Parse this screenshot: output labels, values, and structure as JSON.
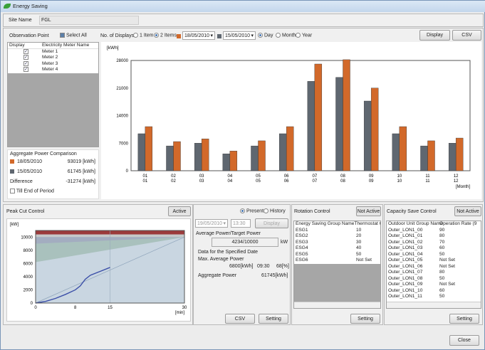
{
  "window": {
    "title": "Energy Saving"
  },
  "site": {
    "label": "Site Name",
    "value": "FGL"
  },
  "observation": {
    "label": "Observation Point",
    "select_all": "Select All",
    "columns": [
      "Display",
      "Electricity Meter Name"
    ],
    "meters": [
      {
        "name": "Meter 1",
        "checked": true
      },
      {
        "name": "Meter 2",
        "checked": true
      },
      {
        "name": "Meter 3",
        "checked": true
      },
      {
        "name": "Meter 4",
        "checked": true
      }
    ]
  },
  "displays": {
    "label": "No. of Displays",
    "opt1": "1 Item",
    "opt2": "2 Items",
    "selected": "2 Items",
    "date1": "18/05/2010",
    "date2": "15/05/2010",
    "period_day": "Day",
    "period_month": "Month",
    "period_year": "Year",
    "period_selected": "Day",
    "display_btn": "Display",
    "csv_btn": "CSV"
  },
  "aggregate": {
    "title": "Aggregate Power Comparison",
    "row1_date": "18/05/2010",
    "row1_value": "93019 [kWh]",
    "row2_date": "15/05/2010",
    "row2_value": "61745 [kWh]",
    "diff_label": "Difference",
    "diff_value": "-31274 [kWh]",
    "till_end": "Till End of Period"
  },
  "colors": {
    "series1": "#d2692a",
    "series2": "#5f6770",
    "peak_red": "#9b3b3b"
  },
  "chart_data": {
    "type": "bar",
    "ylabel": "[kWh]",
    "xlabel": "[Month]",
    "ylim": [
      0,
      28000
    ],
    "yticks": [
      "0",
      "7000",
      "14000",
      "21000",
      "28000"
    ],
    "categories": [
      "01\n01",
      "02\n02",
      "03\n03",
      "04\n04",
      "05\n05",
      "06\n06",
      "07\n07",
      "08\n08",
      "09\n09",
      "10\n10",
      "11\n11",
      "12\n12"
    ],
    "series": [
      {
        "values": [
          9400,
          6300,
          7000,
          4300,
          6300,
          9400,
          22700,
          23700,
          17700,
          9400,
          6300,
          7000
        ]
      },
      {
        "values": [
          11200,
          7400,
          8100,
          5000,
          7600,
          11200,
          27100,
          28200,
          21000,
          11200,
          7600,
          8300
        ]
      }
    ]
  },
  "peak": {
    "title": "Peak Cut Control",
    "status": "Active",
    "ylabel": "[kW]",
    "xlabel": "[min]",
    "yticks": [
      "0",
      "2000",
      "4000",
      "6000",
      "8000",
      "10000"
    ],
    "xticks": [
      "0",
      "8",
      "15",
      "30"
    ],
    "present": "Present",
    "history": "History",
    "date": "19/05/2010",
    "time": "13:30",
    "display_btn": "Display",
    "avg_label": "Average Power/Target Power",
    "avg_value": "4234/10000",
    "avg_unit": "kW",
    "specified": "Data for the Specified Date",
    "max_label": "Max. Average Power",
    "max_value": "6800[kWh]",
    "max_time": "09:30",
    "max_pct": "68[%]",
    "agg_label": "Aggregate Power",
    "agg_value": "61745[kWh]",
    "csv_btn": "CSV",
    "setting_btn": "Setting"
  },
  "rotation": {
    "title": "Rotation Control",
    "status": "Not Active",
    "columns": [
      "Energy Saving Group Name",
      "Thermostat C"
    ],
    "rows": [
      [
        "ESG1",
        "10"
      ],
      [
        "ESG2",
        "20"
      ],
      [
        "ESG3",
        "30"
      ],
      [
        "ESG4",
        "40"
      ],
      [
        "ESG5",
        "50"
      ],
      [
        "ESG6",
        "Not Set"
      ]
    ],
    "setting_btn": "Setting"
  },
  "capacity": {
    "title": "Capacity Save Control",
    "status": "Not Active",
    "columns": [
      "Outdoor Unit Group Name",
      "Operation Rate (9"
    ],
    "rows": [
      [
        "Outer_LON1_00",
        "90"
      ],
      [
        "Outer_LON1_01",
        "80"
      ],
      [
        "Outer_LON1_02",
        "70"
      ],
      [
        "Outer_LON1_03",
        "60"
      ],
      [
        "Outer_LON1_04",
        "50"
      ],
      [
        "Outer_LON1_05",
        "Not Set"
      ],
      [
        "Outer_LON1_06",
        "Not Set"
      ],
      [
        "Outer_LON1_07",
        "80"
      ],
      [
        "Outer_LON1_08",
        "50"
      ],
      [
        "Outer_LON1_09",
        "Not Set"
      ],
      [
        "Outer_LON1_10",
        "60"
      ],
      [
        "Outer_LON1_11",
        "50"
      ]
    ],
    "setting_btn": "Setting"
  },
  "close_btn": "Close"
}
